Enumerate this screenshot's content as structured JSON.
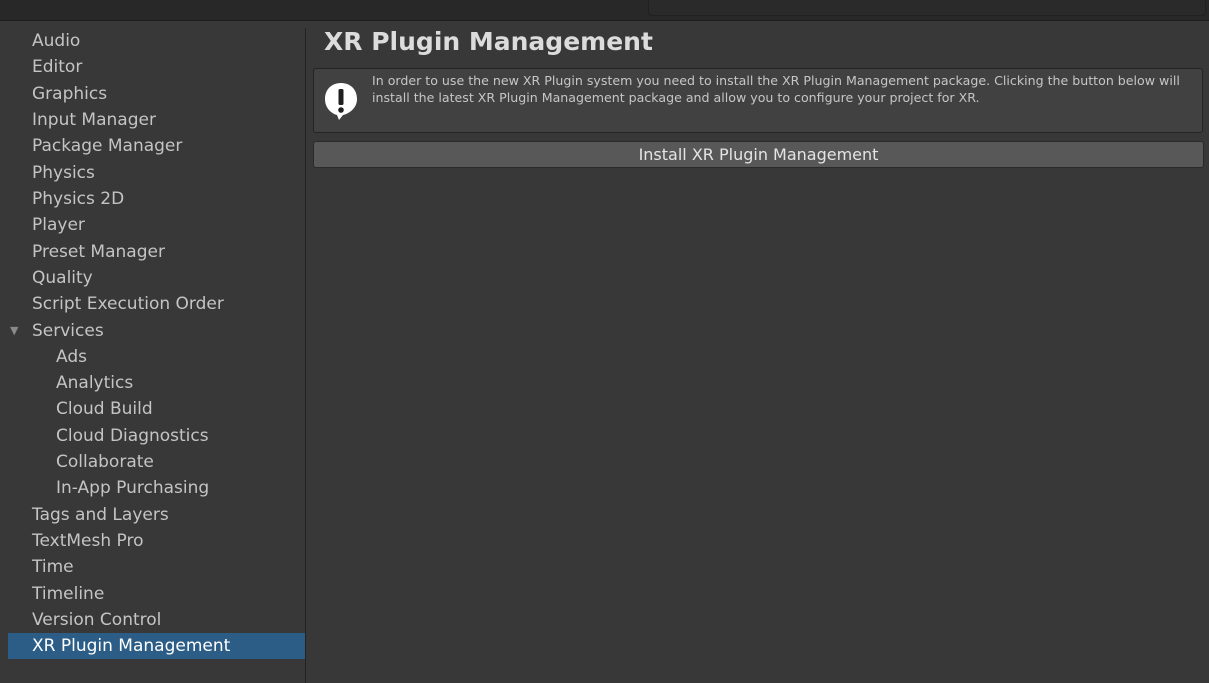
{
  "sidebar": {
    "items": [
      {
        "label": "Audio"
      },
      {
        "label": "Editor"
      },
      {
        "label": "Graphics"
      },
      {
        "label": "Input Manager"
      },
      {
        "label": "Package Manager"
      },
      {
        "label": "Physics"
      },
      {
        "label": "Physics 2D"
      },
      {
        "label": "Player"
      },
      {
        "label": "Preset Manager"
      },
      {
        "label": "Quality"
      },
      {
        "label": "Script Execution Order"
      },
      {
        "label": "Services",
        "expanded": true
      },
      {
        "label": "Ads"
      },
      {
        "label": "Analytics"
      },
      {
        "label": "Cloud Build"
      },
      {
        "label": "Cloud Diagnostics"
      },
      {
        "label": "Collaborate"
      },
      {
        "label": "In-App Purchasing"
      },
      {
        "label": "Tags and Layers"
      },
      {
        "label": "TextMesh Pro"
      },
      {
        "label": "Time"
      },
      {
        "label": "Timeline"
      },
      {
        "label": "Version Control"
      },
      {
        "label": "XR Plugin Management",
        "selected": true
      }
    ],
    "foldout_glyph": "▼"
  },
  "main": {
    "title": "XR Plugin Management",
    "help": {
      "icon": "warning-icon",
      "text": "In order to use the new XR Plugin system you need to install the XR Plugin Management package. Clicking the button below will install the latest XR Plugin Management package and allow you to configure your project for XR."
    },
    "install_button_label": "Install XR Plugin Management"
  },
  "colors": {
    "background": "#383838",
    "selection": "#2c5d87",
    "text": "#c4c4c4",
    "button": "#585858"
  }
}
